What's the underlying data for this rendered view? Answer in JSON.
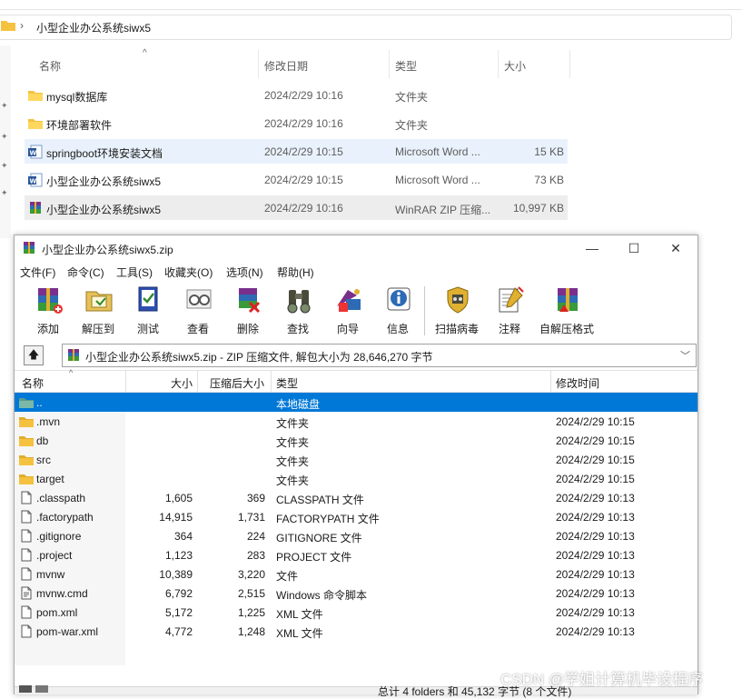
{
  "explorer": {
    "breadcrumb_separator": "›",
    "breadcrumb": "小型企业办公系统siwx5",
    "columns": {
      "name": "名称",
      "date": "修改日期",
      "type": "类型",
      "size": "大小"
    },
    "rows": [
      {
        "name": "mysql数据库",
        "date": "2024/2/29 10:16",
        "type": "文件夹",
        "size": "",
        "icon": "folder-icon"
      },
      {
        "name": "环境部署软件",
        "date": "2024/2/29 10:16",
        "type": "文件夹",
        "size": "",
        "icon": "folder-icon"
      },
      {
        "name": "springboot环境安装文档",
        "date": "2024/2/29 10:15",
        "type": "Microsoft Word ...",
        "size": "15 KB",
        "icon": "word-doc-icon"
      },
      {
        "name": "小型企业办公系统siwx5",
        "date": "2024/2/29 10:15",
        "type": "Microsoft Word ...",
        "size": "73 KB",
        "icon": "word-doc-icon"
      },
      {
        "name": "小型企业办公系统siwx5",
        "date": "2024/2/29 10:16",
        "type": "WinRAR ZIP 压缩...",
        "size": "10,997 KB",
        "icon": "winrar-archive-icon"
      }
    ]
  },
  "winrar": {
    "title": "小型企业办公系统siwx5.zip",
    "window_buttons": {
      "minimize": "—",
      "maximize": "☐",
      "close": "✕"
    },
    "menu": [
      "文件(F)",
      "命令(C)",
      "工具(S)",
      "收藏夹(O)",
      "选项(N)",
      "帮助(H)"
    ],
    "toolbar": [
      {
        "label": "添加",
        "icon": "add-icon"
      },
      {
        "label": "解压到",
        "icon": "extract-to-icon"
      },
      {
        "label": "测试",
        "icon": "test-icon"
      },
      {
        "label": "查看",
        "icon": "view-icon"
      },
      {
        "label": "删除",
        "icon": "delete-icon"
      },
      {
        "label": "查找",
        "icon": "find-icon"
      },
      {
        "label": "向导",
        "icon": "wizard-icon"
      },
      {
        "label": "信息",
        "icon": "info-icon"
      },
      {
        "label": "扫描病毒",
        "icon": "virus-scan-icon"
      },
      {
        "label": "注释",
        "icon": "comment-icon"
      },
      {
        "label": "自解压格式",
        "icon": "sfx-icon"
      }
    ],
    "path": "小型企业办公系统siwx5.zip - ZIP 压缩文件, 解包大小为 28,646,270 字节",
    "columns": {
      "name": "名称",
      "size": "大小",
      "packed": "压缩后大小",
      "type": "类型",
      "modified": "修改时间"
    },
    "rows": [
      {
        "name": "..",
        "size": "",
        "packed": "",
        "type": "本地磁盘",
        "modified": "",
        "icon": "parent-folder-icon",
        "selected": true
      },
      {
        "name": ".mvn",
        "size": "",
        "packed": "",
        "type": "文件夹",
        "modified": "2024/2/29 10:15",
        "icon": "folder-icon"
      },
      {
        "name": "db",
        "size": "",
        "packed": "",
        "type": "文件夹",
        "modified": "2024/2/29 10:15",
        "icon": "folder-icon"
      },
      {
        "name": "src",
        "size": "",
        "packed": "",
        "type": "文件夹",
        "modified": "2024/2/29 10:15",
        "icon": "folder-icon"
      },
      {
        "name": "target",
        "size": "",
        "packed": "",
        "type": "文件夹",
        "modified": "2024/2/29 10:15",
        "icon": "folder-icon"
      },
      {
        "name": ".classpath",
        "size": "1,605",
        "packed": "369",
        "type": "CLASSPATH 文件",
        "modified": "2024/2/29 10:13",
        "icon": "file-icon"
      },
      {
        "name": ".factorypath",
        "size": "14,915",
        "packed": "1,731",
        "type": "FACTORYPATH 文件",
        "modified": "2024/2/29 10:13",
        "icon": "file-icon"
      },
      {
        "name": ".gitignore",
        "size": "364",
        "packed": "224",
        "type": "GITIGNORE 文件",
        "modified": "2024/2/29 10:13",
        "icon": "file-icon"
      },
      {
        "name": ".project",
        "size": "1,123",
        "packed": "283",
        "type": "PROJECT 文件",
        "modified": "2024/2/29 10:13",
        "icon": "file-icon"
      },
      {
        "name": "mvnw",
        "size": "10,389",
        "packed": "3,220",
        "type": "文件",
        "modified": "2024/2/29 10:13",
        "icon": "file-icon"
      },
      {
        "name": "mvnw.cmd",
        "size": "6,792",
        "packed": "2,515",
        "type": "Windows 命令脚本",
        "modified": "2024/2/29 10:13",
        "icon": "script-file-icon"
      },
      {
        "name": "pom.xml",
        "size": "5,172",
        "packed": "1,225",
        "type": "XML 文件",
        "modified": "2024/2/29 10:13",
        "icon": "file-icon"
      },
      {
        "name": "pom-war.xml",
        "size": "4,772",
        "packed": "1,248",
        "type": "XML 文件",
        "modified": "2024/2/29 10:13",
        "icon": "file-icon"
      }
    ],
    "status": "总计 4 folders 和 45,132 字节 (8 个文件)"
  },
  "watermark": "CSDN @学姐计算机毕设程序",
  "colors": {
    "selection": "#0078d7",
    "folder": "#f4c23f",
    "explorer_hover": "#e9f2fc"
  }
}
